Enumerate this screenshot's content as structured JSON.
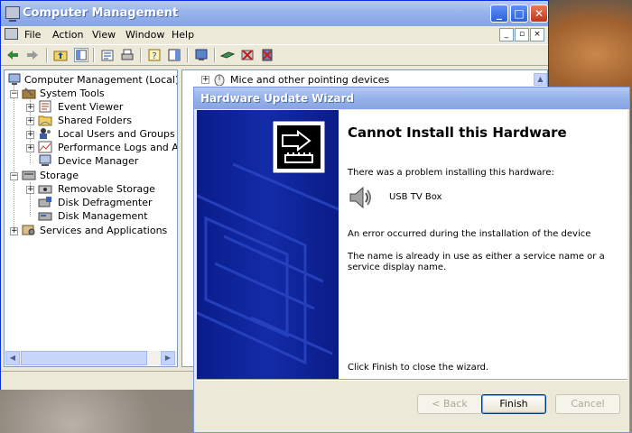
{
  "main_window": {
    "title": "Computer Management",
    "menu": [
      "File",
      "Action",
      "View",
      "Window",
      "Help"
    ],
    "mdi_controls": [
      "_",
      "▫",
      "×"
    ]
  },
  "tree": {
    "root": "Computer Management (Local)",
    "system_tools": "System Tools",
    "event_viewer": "Event Viewer",
    "shared_folders": "Shared Folders",
    "local_users": "Local Users and Groups",
    "performance_logs": "Performance Logs and Alerts",
    "device_manager": "Device Manager",
    "storage": "Storage",
    "removable_storage": "Removable Storage",
    "disk_defragmenter": "Disk Defragmenter",
    "disk_management": "Disk Management",
    "services_apps": "Services and Applications"
  },
  "right_pane": {
    "visible_item": "Mice and other pointing devices"
  },
  "wizard": {
    "title": "Hardware Update Wizard",
    "heading": "Cannot Install this Hardware",
    "problem_text": "There was a problem installing this hardware:",
    "device_name": "USB TV Box",
    "error_text": "An error occurred during the installation of the device",
    "detail_text": "The name is already in use as either a service name or a service display name.",
    "finish_hint": "Click Finish to close the wizard.",
    "buttons": {
      "back": "< Back",
      "finish": "Finish",
      "cancel": "Cancel"
    }
  }
}
